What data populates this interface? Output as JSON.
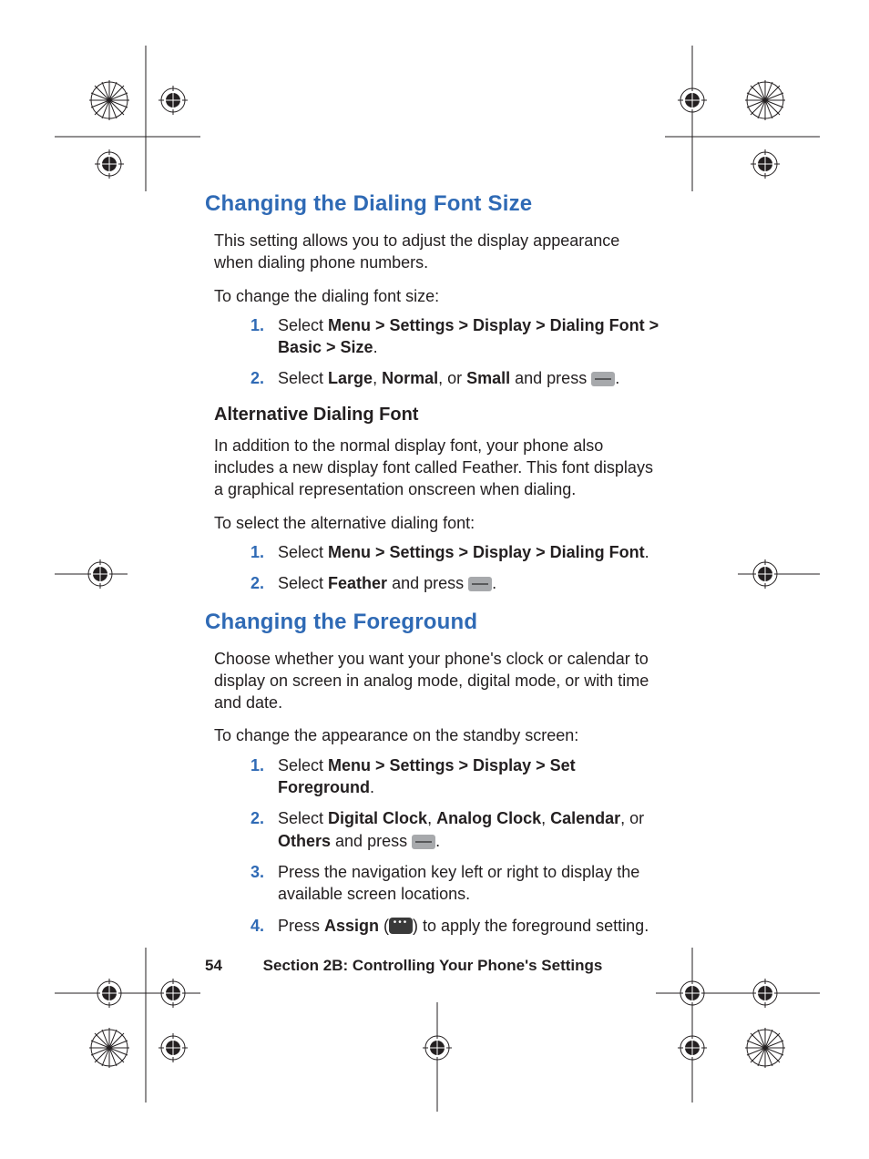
{
  "section1": {
    "heading": "Changing the Dialing Font Size",
    "intro": "This setting allows you to adjust the display appearance when dialing phone numbers.",
    "lead": "To change the dialing font size:",
    "steps": {
      "s1_a": "Select ",
      "s1_b": "Menu > Settings > Display > Dialing Font > Basic > Size",
      "s1_c": ".",
      "s2_a": "Select ",
      "s2_b": "Large",
      "s2_c": ", ",
      "s2_d": "Normal",
      "s2_e": ", or ",
      "s2_f": "Small",
      "s2_g": " and press ",
      "s2_h": "."
    }
  },
  "section1b": {
    "heading": "Alternative Dialing Font",
    "intro": "In addition to the normal display font, your phone also includes a new display font called Feather. This font displays a graphical representation onscreen when dialing.",
    "lead": "To select the alternative dialing font:",
    "steps": {
      "s1_a": "Select ",
      "s1_b": "Menu > Settings > Display > Dialing Font",
      "s1_c": ".",
      "s2_a": "Select ",
      "s2_b": "Feather",
      "s2_c": " and press ",
      "s2_d": "."
    }
  },
  "section2": {
    "heading": "Changing the Foreground",
    "intro": "Choose whether you want your phone's clock or calendar to display on screen in analog mode, digital mode, or with time and date.",
    "lead": "To change the appearance on the standby screen:",
    "steps": {
      "s1_a": "Select ",
      "s1_b": "Menu > Settings > Display > Set Foreground",
      "s1_c": ".",
      "s2_a": "Select ",
      "s2_b": "Digital Clock",
      "s2_c": ", ",
      "s2_d": "Analog Clock",
      "s2_e": ", ",
      "s2_f": "Calendar",
      "s2_g": ", or ",
      "s2_h": "Others",
      "s2_i": " and press ",
      "s2_j": ".",
      "s3": "Press the navigation key left or right to display the available screen locations.",
      "s4_a": "Press ",
      "s4_b": "Assign",
      "s4_c": " (",
      "s4_d": ") to apply the foreground setting."
    }
  },
  "footer": {
    "page": "54",
    "section": "Section 2B: Controlling Your Phone's Settings"
  }
}
